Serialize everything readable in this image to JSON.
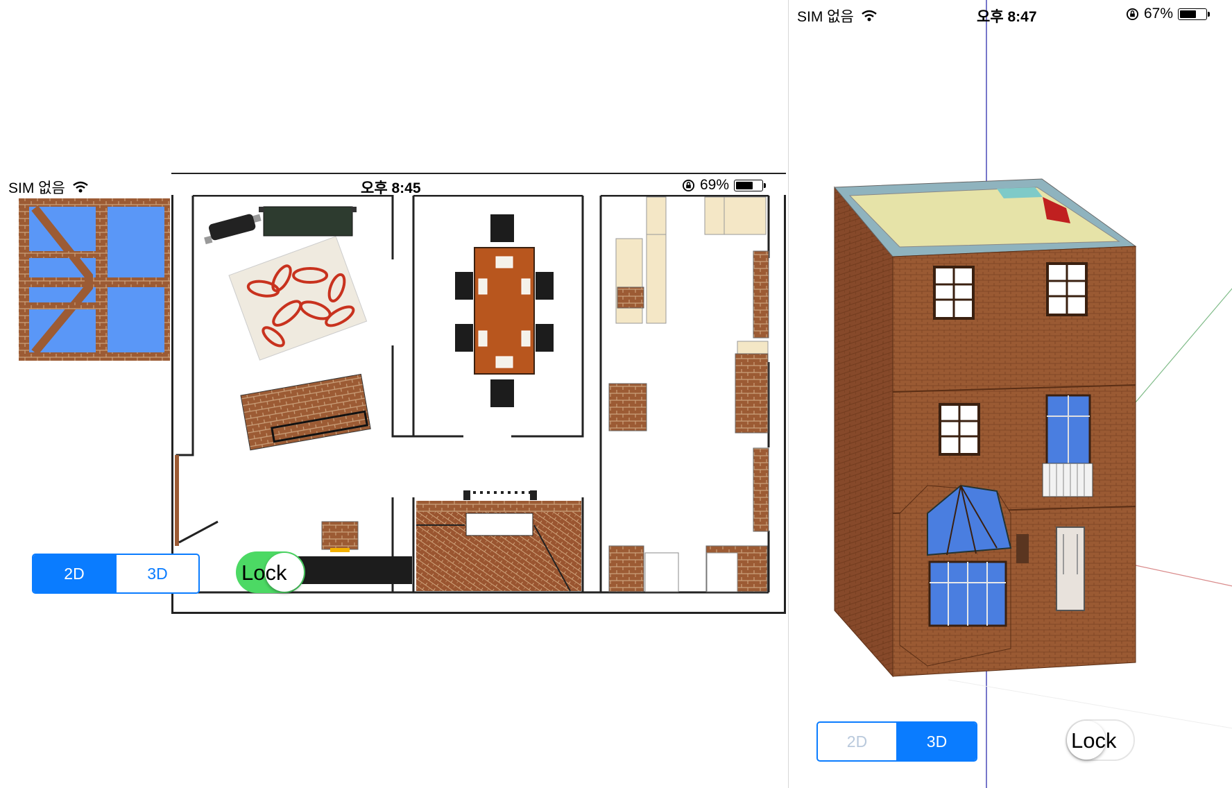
{
  "left_screen": {
    "status_bar": {
      "carrier": "SIM 없음",
      "time": "오후 8:45",
      "battery": "69%",
      "battery_level": 0.69,
      "icons": [
        "wifi-icon",
        "rotation-lock-icon",
        "battery-icon"
      ]
    },
    "view_mode": {
      "options": [
        "2D",
        "3D"
      ],
      "selected": "2D"
    },
    "lock_toggle": {
      "label": "Lock",
      "on": true
    },
    "canvas": "2d-floor-plan"
  },
  "right_screen": {
    "status_bar": {
      "carrier": "SIM 없음",
      "time": "오후 8:47",
      "battery": "67%",
      "battery_level": 0.67,
      "icons": [
        "wifi-icon",
        "rotation-lock-icon",
        "battery-icon"
      ]
    },
    "view_mode": {
      "options": [
        "2D",
        "3D"
      ],
      "selected": "3D"
    },
    "lock_toggle": {
      "label": "Lock",
      "on": false
    },
    "canvas": "3d-house-model"
  },
  "colors": {
    "ios_blue": "#0a7cff",
    "toggle_green": "#4cd964",
    "brick": "#9a5a33",
    "glass_blue": "#5b8ff0",
    "table_wood": "#b8561e",
    "rug_red": "#c8321e"
  }
}
